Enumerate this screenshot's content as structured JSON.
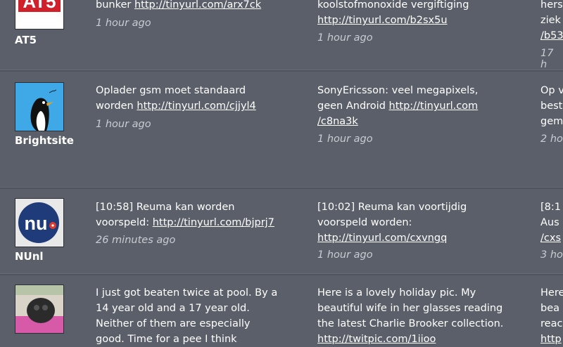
{
  "rows": [
    {
      "user": "AT5",
      "col1": {
        "pre": "bunker ",
        "link": "http://tinyurl.com/arx7ck",
        "time": "1 hour ago"
      },
      "col2": {
        "pre": "koolstofmonoxide vergiftiging",
        "link": "http://tinyurl.com/b2sx5u",
        "time": "1 hour ago"
      },
      "col3": {
        "line1": "hers",
        "line2": "ziek",
        "line3": "/b53",
        "time": "17 h"
      }
    },
    {
      "user": "Brightsite",
      "col1": {
        "line1": "Oplader gsm moet standaard",
        "pre": "worden ",
        "link": "http://tinyurl.com/cjjyl4",
        "time": "1 hour ago"
      },
      "col2": {
        "line1": "SonyEricsson: veel megapixels,",
        "pre": "geen Android ",
        "link": "http://tinyurl.com",
        "link2": "/c8na3k",
        "time": "1 hour ago"
      },
      "col3": {
        "line1": "Op v",
        "line2": "best",
        "line3": "gem",
        "time": "2 ho"
      }
    },
    {
      "user": "NUnl",
      "col1": {
        "line1": "[10:58] Reuma kan worden",
        "pre": "voorspeld: ",
        "link": "http://tinyurl.com/bjprj7",
        "time": "26 minutes ago"
      },
      "col2": {
        "line1": "[10:02] Reuma kan voortijdig",
        "line2": "voorspeld worden:",
        "link": "http://tinyurl.com/cxvngq",
        "time": "1 hour ago"
      },
      "col3": {
        "line1": "[8:1",
        "line2": "Aus",
        "line3": "/cxs",
        "time": "3 ho"
      }
    },
    {
      "user": "",
      "col1": {
        "line1": "I just got beaten twice at pool. By a",
        "line2": "14 year old and a 17 year old.",
        "line3": "Neither of them are especially",
        "line4": "good. Time for a pee I think"
      },
      "col2": {
        "line1": "Here is a lovely holiday pic. My",
        "line2": "beautiful wife in her glasses reading",
        "line3": "the latest Charlie Brooker collection.",
        "line4": "http://twitpic.com/1iioo"
      },
      "col3": {
        "line1": "Here",
        "line2": "bea",
        "line3": "reac",
        "line4": "http"
      }
    }
  ],
  "colors": {
    "background": "#5b5f69",
    "link": "#ffffff",
    "time": "#c9ccd3"
  }
}
